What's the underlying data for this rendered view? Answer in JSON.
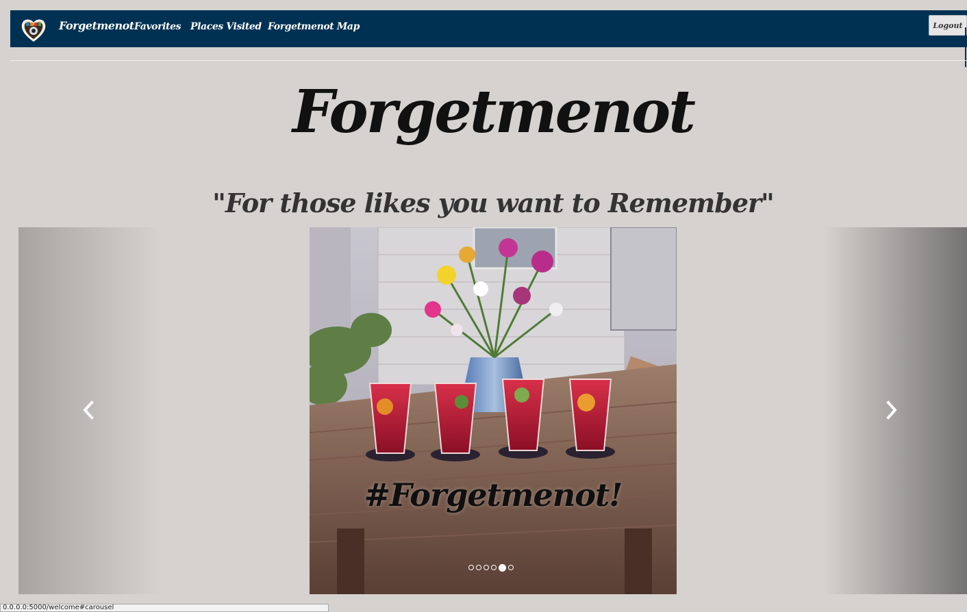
{
  "navbar": {
    "brand_name": "Forgetmenot",
    "links": [
      {
        "label": "Favorites"
      },
      {
        "label": "Places Visited"
      },
      {
        "label": "Forgetmenot Map"
      }
    ],
    "logout_label": "Logout",
    "background_color": "#003153"
  },
  "hero": {
    "title": "Forgetmenot",
    "tagline": "\"For those likes you want to Remember\""
  },
  "carousel": {
    "caption": "#Forgetmenot!",
    "slide_count": 6,
    "active_index": 4,
    "prev_icon": "chevron-left-icon",
    "next_icon": "chevron-right-icon"
  },
  "status_bar": {
    "url": "0.0.0.0:5000/welcome#carousel"
  }
}
